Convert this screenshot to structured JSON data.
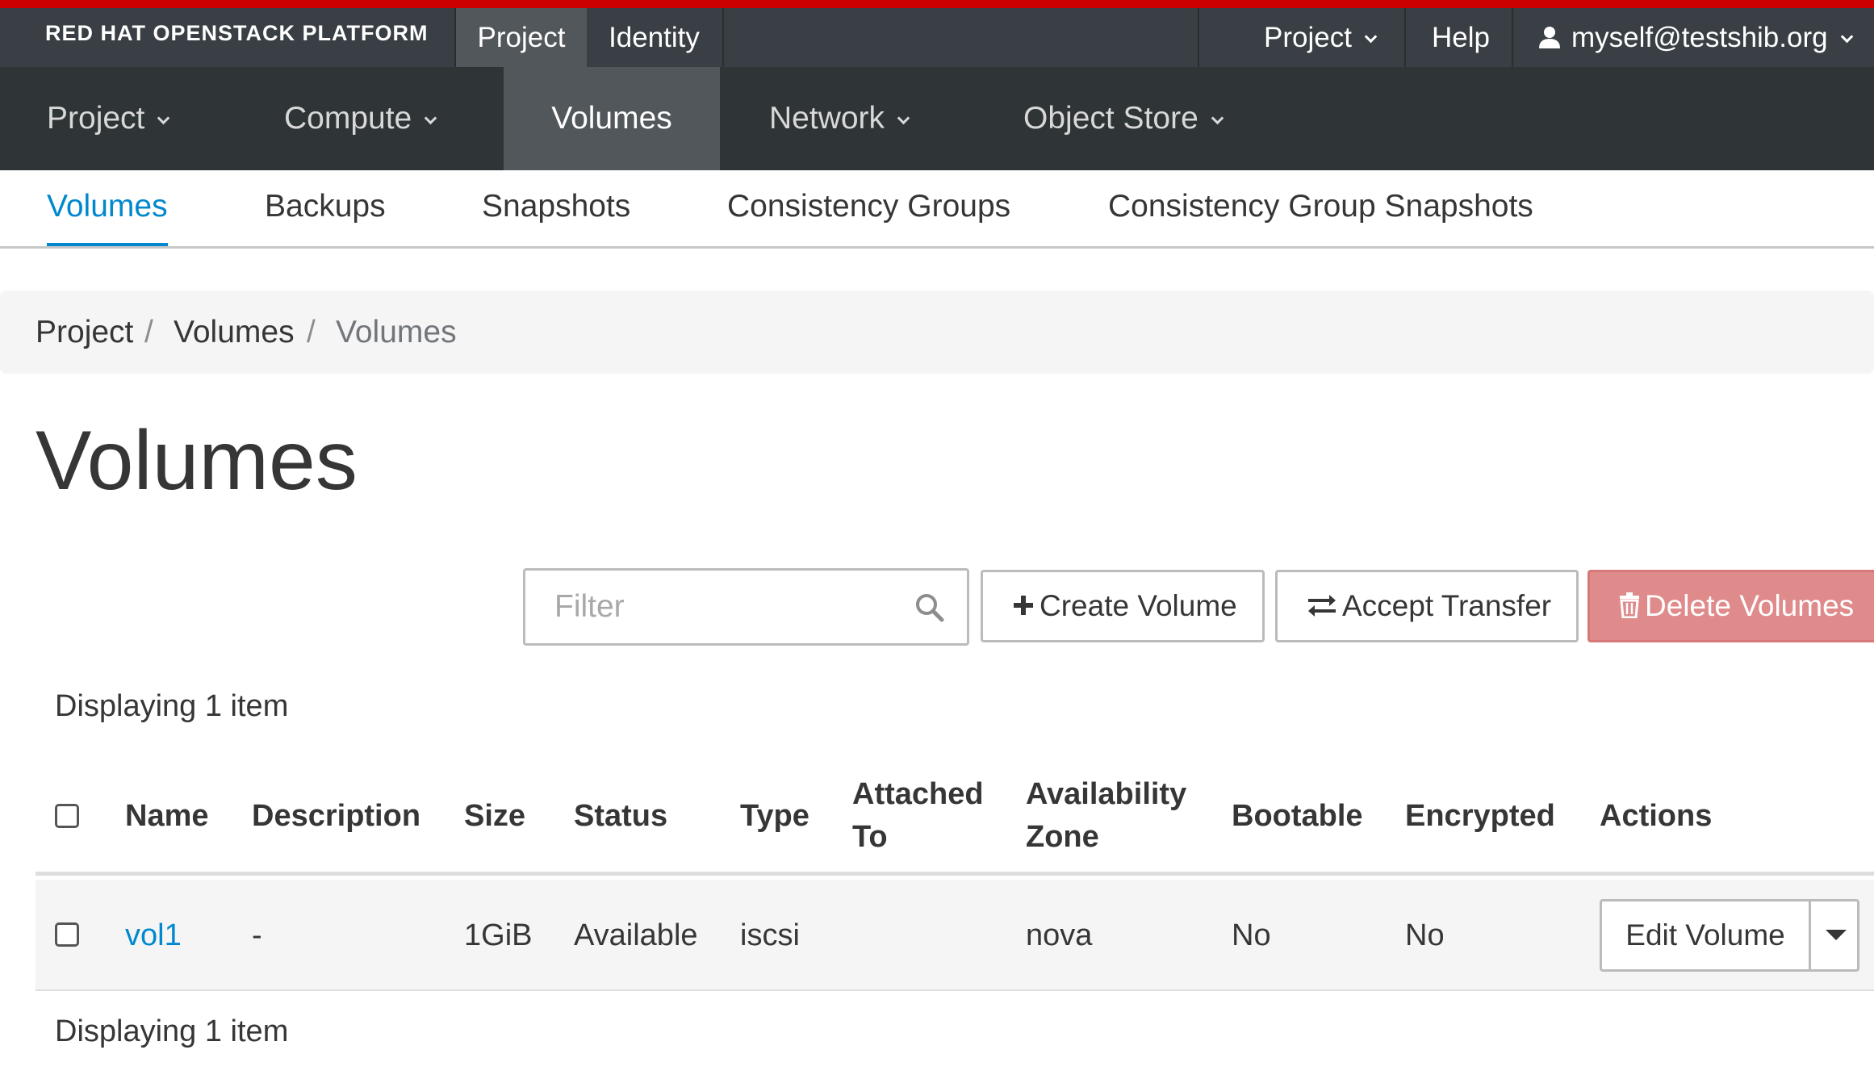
{
  "brand": {
    "text": "RED HAT OPENSTACK PLATFORM"
  },
  "topbar": {
    "tabs": [
      {
        "label": "Project"
      },
      {
        "label": "Identity"
      }
    ],
    "project_menu": "Project",
    "help": "Help",
    "user": "myself@testshib.org"
  },
  "nav": {
    "items": [
      {
        "label": "Project"
      },
      {
        "label": "Compute"
      },
      {
        "label": "Volumes"
      },
      {
        "label": "Network"
      },
      {
        "label": "Object Store"
      }
    ]
  },
  "subnav": {
    "items": [
      {
        "label": "Volumes"
      },
      {
        "label": "Backups"
      },
      {
        "label": "Snapshots"
      },
      {
        "label": "Consistency Groups"
      },
      {
        "label": "Consistency Group Snapshots"
      }
    ]
  },
  "breadcrumb": {
    "items": [
      "Project",
      "Volumes",
      "Volumes"
    ],
    "separator": "/"
  },
  "page": {
    "title": "Volumes"
  },
  "toolbar": {
    "filter_placeholder": "Filter",
    "create_label": "Create Volume",
    "accept_label": "Accept Transfer",
    "delete_label": "Delete Volumes"
  },
  "table": {
    "count_text": "Displaying 1 item",
    "headers": {
      "name": "Name",
      "description": "Description",
      "size": "Size",
      "status": "Status",
      "type": "Type",
      "attached_1": "Attached",
      "attached_2": "To",
      "zone_1": "Availability",
      "zone_2": "Zone",
      "bootable": "Bootable",
      "encrypted": "Encrypted",
      "actions": "Actions"
    },
    "rows": [
      {
        "name": "vol1",
        "description": "-",
        "size": "1GiB",
        "status": "Available",
        "type": "iscsi",
        "attached_to": "",
        "zone": "nova",
        "bootable": "No",
        "encrypted": "No",
        "action": "Edit Volume"
      }
    ]
  },
  "colors": {
    "accent": "#cc0000",
    "link": "#0088ce",
    "danger": "#e08b8b",
    "topbar": "#393f44",
    "navbar": "#2f3437"
  }
}
